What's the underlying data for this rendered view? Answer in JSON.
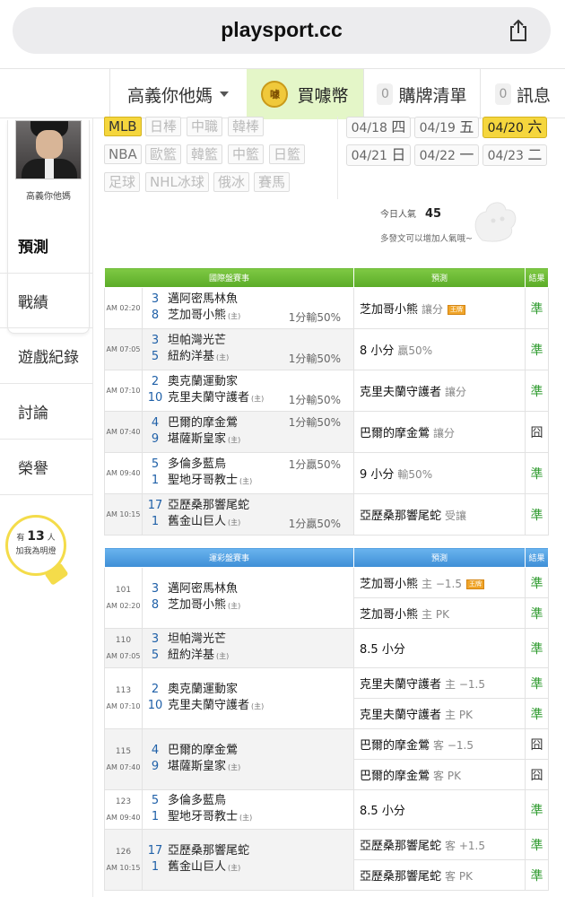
{
  "browser": {
    "url": "playsport.cc",
    "share_icon": "share-icon"
  },
  "nav": {
    "user": "高義你他媽",
    "coin": "買噱幣",
    "coin_icon_text": "噱",
    "cart_count": "0",
    "cart": "購牌清單",
    "msg_count": "0",
    "msg": "訊息"
  },
  "sidebar": {
    "avatar_name": "高義你他媽",
    "items": [
      "預測",
      "戰績",
      "遊戲紀錄",
      "討論",
      "榮譽"
    ],
    "fans_prefix": "有",
    "fans_count": "13",
    "fans_unit": "人",
    "fans_suffix": "加我為明燈"
  },
  "filters": {
    "row1": [
      "MLB",
      "日棒",
      "中職",
      "韓棒"
    ],
    "row2": [
      "NBA",
      "歐籃",
      "韓籃",
      "中籃",
      "日籃"
    ],
    "row3": [
      "足球",
      "NHL冰球",
      "俄冰",
      "賽馬"
    ]
  },
  "dates": [
    {
      "d": "04/18",
      "w": "四"
    },
    {
      "d": "04/19",
      "w": "五"
    },
    {
      "d": "04/20",
      "w": "六"
    },
    {
      "d": "04/21",
      "w": "日"
    },
    {
      "d": "04/22",
      "w": "一"
    },
    {
      "d": "04/23",
      "w": "二"
    }
  ],
  "popularity": {
    "label": "今日人氣",
    "value": "45",
    "tip": "多發文可以增加人氣哦~"
  },
  "intl": {
    "headers": [
      "國際盤賽事",
      "預測",
      "結果"
    ],
    "rows": [
      {
        "ampm": "AM",
        "time": "02:20",
        "n1": "3",
        "t1": "邁阿密馬林魚",
        "n2": "8",
        "t2": "芝加哥小熊",
        "home": "(主)",
        "odds": "1分輸50%",
        "pred": "芝加哥小熊",
        "sub": "讓分",
        "tag": "王牌",
        "res": "準"
      },
      {
        "ampm": "AM",
        "time": "07:05",
        "n1": "3",
        "t1": "坦帕灣光芒",
        "n2": "5",
        "t2": "紐約洋基",
        "home": "(主)",
        "odds": "1分輸50%",
        "pred": "8 小分",
        "sub": "贏50%",
        "tag": "",
        "res": "準"
      },
      {
        "ampm": "AM",
        "time": "07:10",
        "n1": "2",
        "t1": "奧克蘭運動家",
        "n2": "10",
        "t2": "克里夫蘭守護者",
        "home": "(主)",
        "odds": "1分輸50%",
        "pred": "克里夫蘭守護者",
        "sub": "讓分",
        "tag": "",
        "res": "準"
      },
      {
        "ampm": "AM",
        "time": "07:40",
        "n1": "4",
        "t1": "巴爾的摩金鶯",
        "n2": "9",
        "t2": "堪薩斯皇家",
        "home": "(主)",
        "odds": "1分輸50%",
        "pred": "巴爾的摩金鶯",
        "sub": "讓分",
        "tag": "",
        "res": "囧"
      },
      {
        "ampm": "AM",
        "time": "09:40",
        "n1": "5",
        "t1": "多倫多藍鳥",
        "n2": "1",
        "t2": "聖地牙哥教士",
        "home": "(主)",
        "odds": "1分贏50%",
        "pred": "9 小分",
        "sub": "輸50%",
        "tag": "",
        "res": "準"
      },
      {
        "ampm": "AM",
        "time": "10:15",
        "n1": "17",
        "t1": "亞歷桑那響尾蛇",
        "n2": "1",
        "t2": "舊金山巨人",
        "home": "(主)",
        "odds": "1分贏50%",
        "pred": "亞歷桑那響尾蛇",
        "sub": "受讓",
        "tag": "",
        "res": "準"
      }
    ]
  },
  "lottery": {
    "headers": [
      "運彩盤賽事",
      "預測",
      "結果"
    ],
    "rows": [
      {
        "id": "101",
        "ampm": "AM",
        "time": "02:20",
        "n1": "3",
        "t1": "邁阿密馬林魚",
        "n2": "8",
        "t2": "芝加哥小熊",
        "home": "(主)",
        "preds": [
          {
            "p": "芝加哥小熊",
            "sub": "主 −1.5",
            "tag": "王牌",
            "res": "準"
          },
          {
            "p": "芝加哥小熊",
            "sub": "主 PK",
            "tag": "",
            "res": "準"
          }
        ]
      },
      {
        "id": "110",
        "ampm": "AM",
        "time": "07:05",
        "n1": "3",
        "t1": "坦帕灣光芒",
        "n2": "5",
        "t2": "紐約洋基",
        "home": "(主)",
        "preds": [
          {
            "p": "8.5 小分",
            "sub": "",
            "tag": "",
            "res": "準"
          }
        ]
      },
      {
        "id": "113",
        "ampm": "AM",
        "time": "07:10",
        "n1": "2",
        "t1": "奧克蘭運動家",
        "n2": "10",
        "t2": "克里夫蘭守護者",
        "home": "(主)",
        "preds": [
          {
            "p": "克里夫蘭守護者",
            "sub": "主 −1.5",
            "tag": "",
            "res": "準"
          },
          {
            "p": "克里夫蘭守護者",
            "sub": "主 PK",
            "tag": "",
            "res": "準"
          }
        ]
      },
      {
        "id": "115",
        "ampm": "AM",
        "time": "07:40",
        "n1": "4",
        "t1": "巴爾的摩金鶯",
        "n2": "9",
        "t2": "堪薩斯皇家",
        "home": "(主)",
        "preds": [
          {
            "p": "巴爾的摩金鶯",
            "sub": "客 −1.5",
            "tag": "",
            "res": "囧"
          },
          {
            "p": "巴爾的摩金鶯",
            "sub": "客 PK",
            "tag": "",
            "res": "囧"
          }
        ]
      },
      {
        "id": "123",
        "ampm": "AM",
        "time": "09:40",
        "n1": "5",
        "t1": "多倫多藍鳥",
        "n2": "1",
        "t2": "聖地牙哥教士",
        "home": "(主)",
        "preds": [
          {
            "p": "8.5 小分",
            "sub": "",
            "tag": "",
            "res": "準"
          }
        ]
      },
      {
        "id": "126",
        "ampm": "AM",
        "time": "10:15",
        "n1": "17",
        "t1": "亞歷桑那響尾蛇",
        "n2": "1",
        "t2": "舊金山巨人",
        "home": "(主)",
        "preds": [
          {
            "p": "亞歷桑那響尾蛇",
            "sub": "客 +1.5",
            "tag": "",
            "res": "準"
          },
          {
            "p": "亞歷桑那響尾蛇",
            "sub": "客 PK",
            "tag": "",
            "res": "準"
          }
        ]
      }
    ]
  },
  "colors": {
    "green_header": "#5aab27",
    "blue_header": "#3e8ed6",
    "win": "#2f9b2f",
    "chip_on": "#f5d63d"
  }
}
